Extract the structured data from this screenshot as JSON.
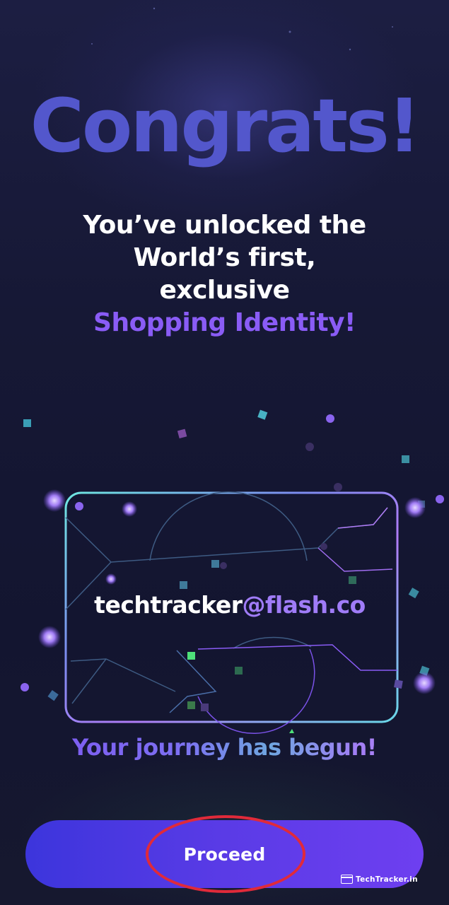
{
  "heading": "Congrats!",
  "subtitle": {
    "line1": "You’ve unlocked the",
    "line2": "World’s first,",
    "line3": "exclusive",
    "highlight": "Shopping Identity!"
  },
  "card": {
    "username": "techtracker",
    "domain": "@flash.co"
  },
  "journey_text": "Your journey has begun!",
  "proceed_button": {
    "label": "Proceed"
  },
  "watermark": "TechTracker.in",
  "colors": {
    "background": "#151733",
    "heading": "#5357cc",
    "highlight": "#8a5cf6",
    "button": "#5a3be6",
    "annotation_ring": "#e02a3a"
  }
}
